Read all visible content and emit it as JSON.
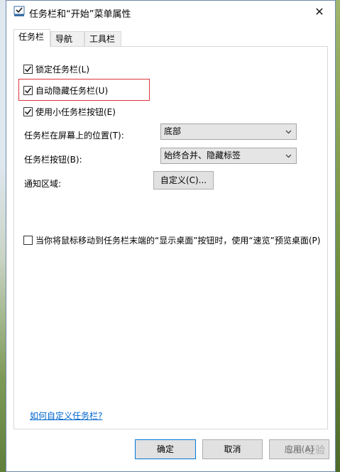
{
  "window": {
    "title": "任务栏和“开始”菜单属性"
  },
  "tabs": [
    {
      "label": "任务栏"
    },
    {
      "label": "导航"
    },
    {
      "label": "工具栏"
    }
  ],
  "options": {
    "lock_taskbar": {
      "label": "锁定任务栏(L)",
      "checked": true
    },
    "auto_hide": {
      "label": "自动隐藏任务栏(U)",
      "checked": true
    },
    "small_buttons": {
      "label": "使用小任务栏按钮(E)",
      "checked": true
    }
  },
  "position": {
    "label": "任务栏在屏幕上的位置(T):",
    "value": "底部"
  },
  "buttons_combine": {
    "label": "任务栏按钮(B):",
    "value": "始终合并、隐藏标签"
  },
  "notification": {
    "label": "通知区域:",
    "button": "自定义(C)..."
  },
  "peek": {
    "label": "当你将鼠标移动到任务栏末端的“显示桌面”按钮时，使用“速览”预览桌面(P)",
    "checked": false
  },
  "help_link": "如何自定义任务栏?",
  "footer": {
    "ok": "确定",
    "cancel": "取消",
    "apply": "应用(A)"
  },
  "watermark": "Bai 经验"
}
